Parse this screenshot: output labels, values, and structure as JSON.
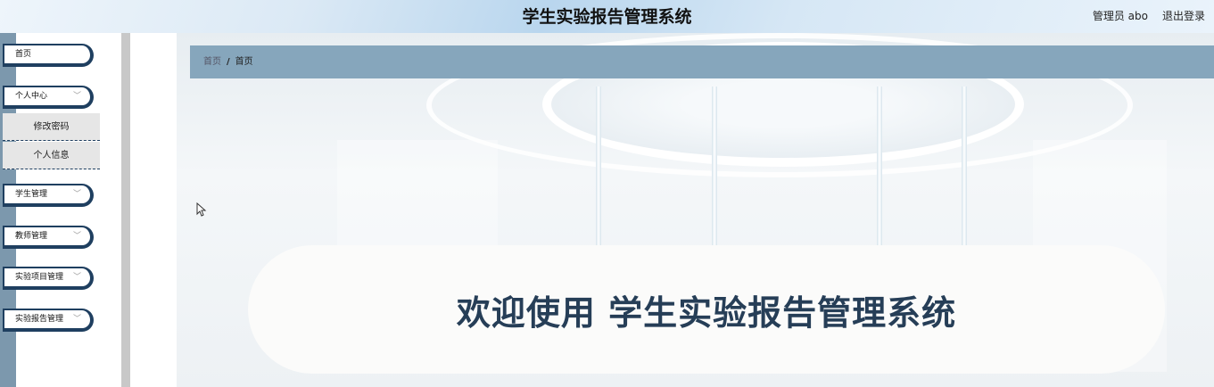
{
  "header": {
    "title": "学生实验报告管理系统",
    "user": "管理员 abo",
    "logout": "退出登录"
  },
  "sidebar": {
    "items": [
      {
        "label": "首页",
        "has_chevron": false
      },
      {
        "label": "个人中心",
        "has_chevron": true
      },
      {
        "label": "学生管理",
        "has_chevron": true
      },
      {
        "label": "教师管理",
        "has_chevron": true
      },
      {
        "label": "实验项目管理",
        "has_chevron": true
      },
      {
        "label": "实验报告管理",
        "has_chevron": true
      }
    ],
    "submenu": [
      {
        "label": "修改密码"
      },
      {
        "label": "个人信息"
      }
    ],
    "chevron": "﹀"
  },
  "breadcrumb": {
    "home": "首页",
    "separator": "/",
    "current": "首页"
  },
  "welcome": {
    "text": "欢迎使用 学生实验报告管理系统"
  },
  "colors": {
    "accent": "#1f3f60",
    "breadcrumb_bg": "#86a6bc",
    "sidebar_strip": "#7c98ad",
    "welcome_text": "#263e57"
  },
  "icons": {
    "chevron": "chevron-down-icon",
    "cursor": "mouse-pointer-icon"
  }
}
